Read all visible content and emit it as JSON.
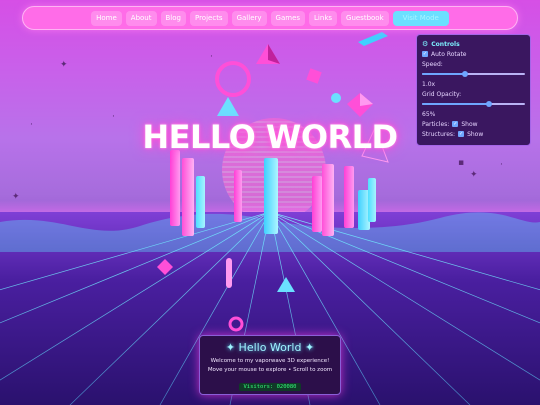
{
  "nav": {
    "items": [
      "Home",
      "About",
      "Blog",
      "Projects",
      "Gallery",
      "Games",
      "Links",
      "Guestbook",
      "Visit Mode"
    ]
  },
  "headline": "HELLO WORLD",
  "controls": {
    "title": "Controls",
    "auto_rotate_label": "Auto Rotate",
    "auto_rotate_checked": true,
    "speed_label": "Speed:",
    "speed_value": "1.0x",
    "speed_fraction": 0.42,
    "grid_opacity_label": "Grid Opacity:",
    "grid_opacity_value": "65%",
    "grid_opacity_fraction": 0.65,
    "particles_label": "Particles:",
    "particles_show_label": "Show",
    "structures_label": "Structures:",
    "structures_show_label": "Show"
  },
  "welcome": {
    "title": "✦ Hello World ✦",
    "line1": "Welcome to my vaporwave 3D experience!",
    "line2": "Move your mouse to explore • Scroll to zoom",
    "visitors": "Visitors: 020080"
  },
  "colors": {
    "nav_bg": "#ff6ce8",
    "accent_cyan": "#6be0ff",
    "accent_pink": "#ff4fd8",
    "panel_bg": "#3a1760"
  }
}
